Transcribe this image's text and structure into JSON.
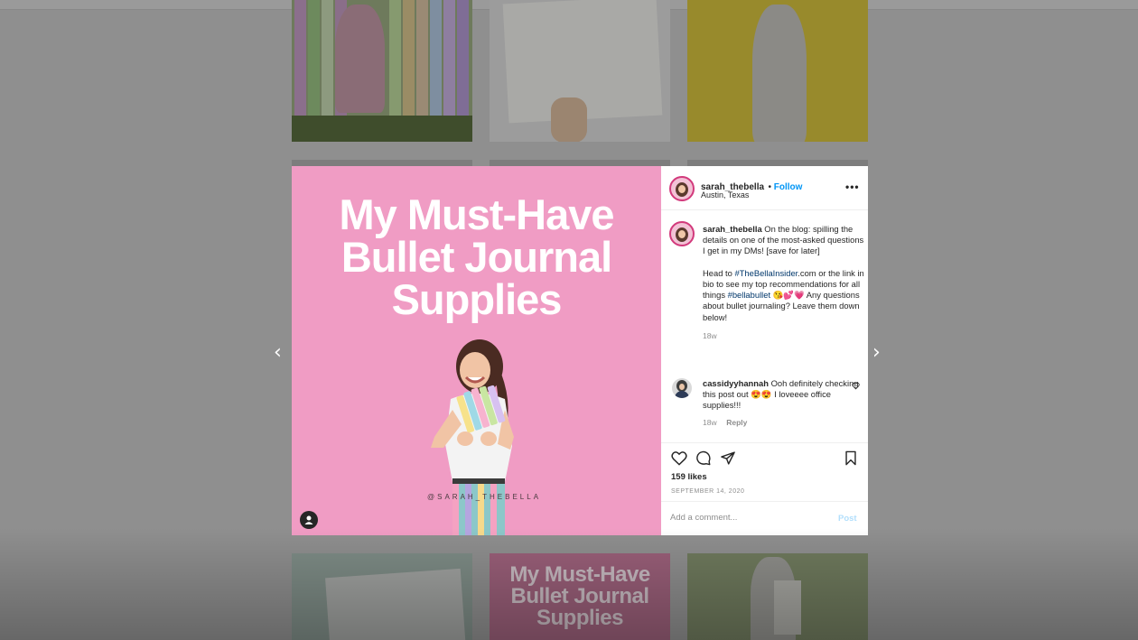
{
  "post": {
    "username": "sarah_thebella",
    "follow_label": "Follow",
    "location": "Austin, Texas",
    "more_label": "•••",
    "image_title_lines": [
      "My Must-Have",
      "Bullet Journal",
      "Supplies"
    ],
    "image_handle": "@SARAH_THEBELLA",
    "caption_username": "sarah_thebella",
    "caption_part1": "On the blog: spilling the details on one of the most-asked questions I get in my DMs! [save for later]",
    "caption_part2_a": "Head to ",
    "caption_hashtag1": "#TheBellaInsider",
    "caption_part2_b": ".com or the link in bio to see my top recommendations for all things ",
    "caption_hashtag2": "#bellabullet",
    "caption_part2_c": " 😘💕💗 Any questions about bullet journaling? Leave them down below!",
    "caption_age": "18w",
    "likes": "159 likes",
    "date": "SEPTEMBER 14, 2020",
    "comment_placeholder": "Add a comment...",
    "post_label": "Post"
  },
  "comment": {
    "username": "cassidyyhannah",
    "text": "Ooh definitely checking this post out 😍😍 I loveeee office supplies!!!",
    "age": "18w",
    "reply_label": "Reply"
  },
  "grid": {
    "tile_title_lines": [
      "My Must-Have",
      "Bullet Journal",
      "Supplies"
    ]
  },
  "nav": {
    "prev_label": "‹",
    "next_label": "›"
  },
  "colors": {
    "pink": "#f09cc4",
    "link_blue": "#0095f6",
    "hashtag": "#00376b"
  }
}
